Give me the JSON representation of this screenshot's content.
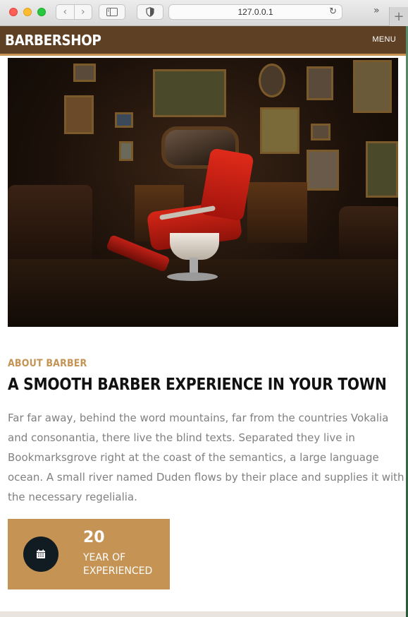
{
  "browser": {
    "url": "127.0.0.1"
  },
  "header": {
    "logo": "BARBERSHOP",
    "menu_label": "MENU"
  },
  "about": {
    "subtitle": "ABOUT BARBER",
    "title": "A SMOOTH BARBER EXPERIENCE IN YOUR TOWN",
    "description": "Far far away, behind the word mountains, far from the countries Vokalia and consonantia, there live the blind texts. Separated they live in Bookmarksgrove right at the coast of the semantics, a large language ocean. A small river named Duden flows by their place and supplies it with the necessary regelialia."
  },
  "stat": {
    "number": "20",
    "label_line1": "YEAR OF",
    "label_line2": "EXPERIENCED",
    "icon": "calendar-icon"
  },
  "colors": {
    "header_bg": "#5e4025",
    "accent": "#c59353",
    "heading": "#111111",
    "body_text": "#808080",
    "icon_circle": "#111b22"
  }
}
